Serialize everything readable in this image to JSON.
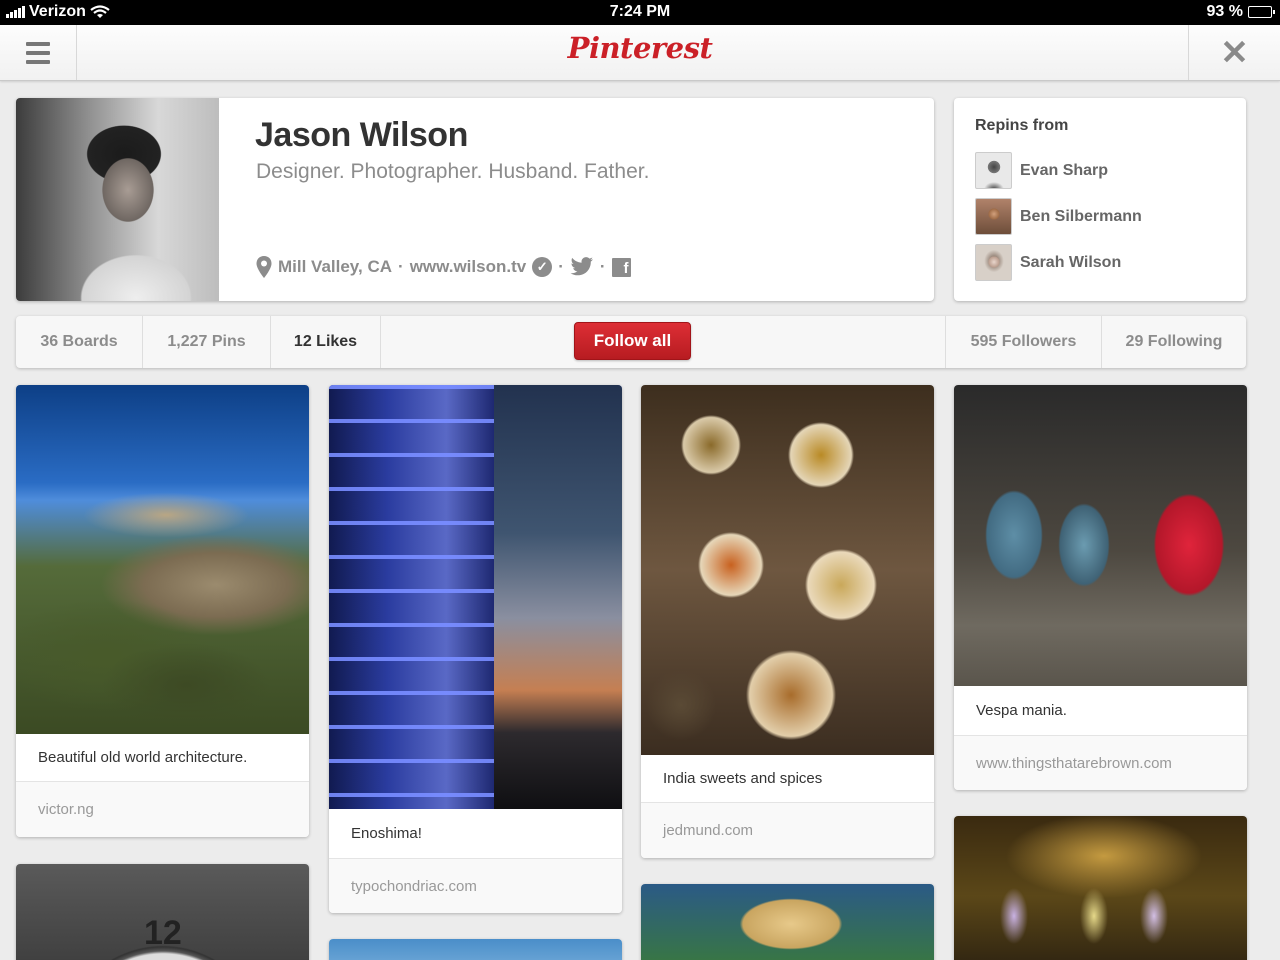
{
  "status_bar": {
    "carrier": "Verizon",
    "time": "7:24 PM",
    "battery": "93 %",
    "battery_level": 0.93
  },
  "nav": {
    "logo": "Pinterest",
    "menu_icon": "hamburger-menu-icon",
    "close_icon": "close-x-icon",
    "close_glyph": "✕"
  },
  "profile": {
    "name": "Jason Wilson",
    "bio": "Designer. Photographer. Husband. Father.",
    "location": "Mill Valley, CA",
    "separator": "·",
    "website": "www.wilson.tv"
  },
  "repins": {
    "title": "Repins from",
    "users": [
      {
        "name": "Evan Sharp"
      },
      {
        "name": "Ben Silbermann"
      },
      {
        "name": "Sarah Wilson"
      }
    ]
  },
  "stats": {
    "boards": "36 Boards",
    "pins": "1,227 Pins",
    "likes": "12 Likes",
    "follow_button": "Follow all",
    "followers": "595 Followers",
    "following": "29 Following"
  },
  "pins": [
    {
      "caption": "Beautiful old world architecture.",
      "source": "victor.ng"
    },
    {
      "caption": "Enoshima!",
      "source": "typochondriac.com"
    },
    {
      "caption": "India sweets and spices",
      "source": "jedmund.com"
    },
    {
      "caption": "Vespa mania.",
      "source": "www.thingsthatarebrown.com"
    }
  ],
  "clock_numeral": "12",
  "colors": {
    "brand_red": "#cb2027",
    "button_red": "#c8232b",
    "background": "#ececec"
  }
}
